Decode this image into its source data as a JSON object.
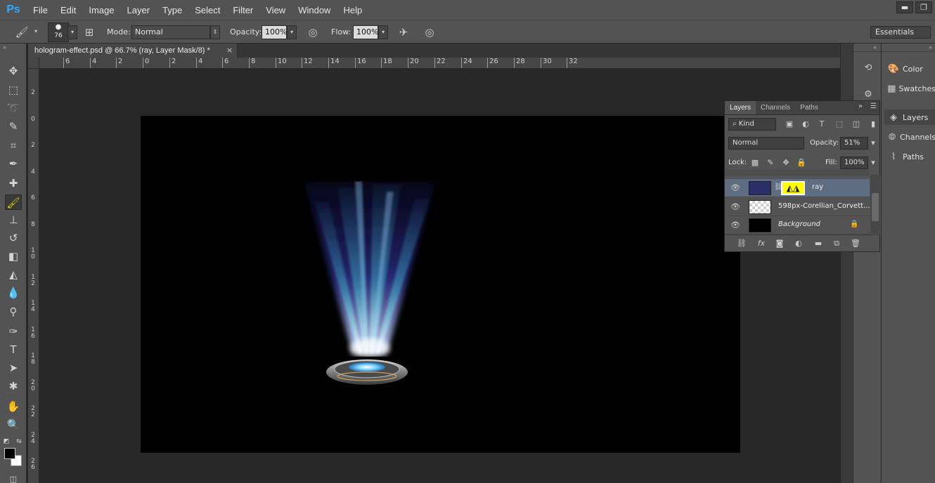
{
  "app": {
    "logo": "Ps",
    "menu": [
      "File",
      "Edit",
      "Image",
      "Layer",
      "Type",
      "Select",
      "Filter",
      "View",
      "Window",
      "Help"
    ],
    "window_buttons": {
      "minimize": "▬",
      "restore": "❐"
    }
  },
  "options_bar": {
    "brush_size": "76",
    "mode_label": "Mode:",
    "mode_value": "Normal",
    "opacity_label": "Opacity:",
    "opacity_value": "100%",
    "flow_label": "Flow:",
    "flow_value": "100%",
    "workspace": "Essentials"
  },
  "document": {
    "tab_title": "hologram-effect.psd @ 66.7% (ray, Layer Mask/8) *",
    "close_glyph": "×"
  },
  "rulers": {
    "horizontal": [
      "6",
      "4",
      "2",
      "0",
      "2",
      "4",
      "6",
      "8",
      "10",
      "12",
      "14",
      "16",
      "18",
      "20",
      "22",
      "24",
      "26",
      "28",
      "30",
      "32"
    ],
    "vertical": [
      "2",
      "0",
      "2",
      "4",
      "6",
      "8",
      "10",
      "12",
      "14",
      "16",
      "18",
      "20",
      "22",
      "24",
      "26"
    ]
  },
  "dock": {
    "panels": [
      "Color",
      "Swatches",
      "Layers",
      "Channels",
      "Paths"
    ],
    "active_panel": "Layers"
  },
  "layers_panel": {
    "tabs": [
      "Layers",
      "Channels",
      "Paths"
    ],
    "filter_kind": "Kind",
    "blend_mode": "Normal",
    "opacity_label": "Opacity:",
    "opacity_value": "51%",
    "lock_label": "Lock:",
    "fill_label": "Fill:",
    "fill_value": "100%",
    "layers": [
      {
        "name": "ray",
        "selected": true,
        "italic": false,
        "locked": false
      },
      {
        "name": "598px-Corellian_Corvett...",
        "selected": false,
        "italic": false,
        "locked": false
      },
      {
        "name": "Background",
        "selected": false,
        "italic": true,
        "locked": true
      }
    ]
  },
  "colors": {
    "foreground": "#000000",
    "background": "#ffffff",
    "active_tool_highlight": "#e8d400",
    "selected_layer": "#5f6d82",
    "layer_mask_fill": "#ffff00"
  }
}
